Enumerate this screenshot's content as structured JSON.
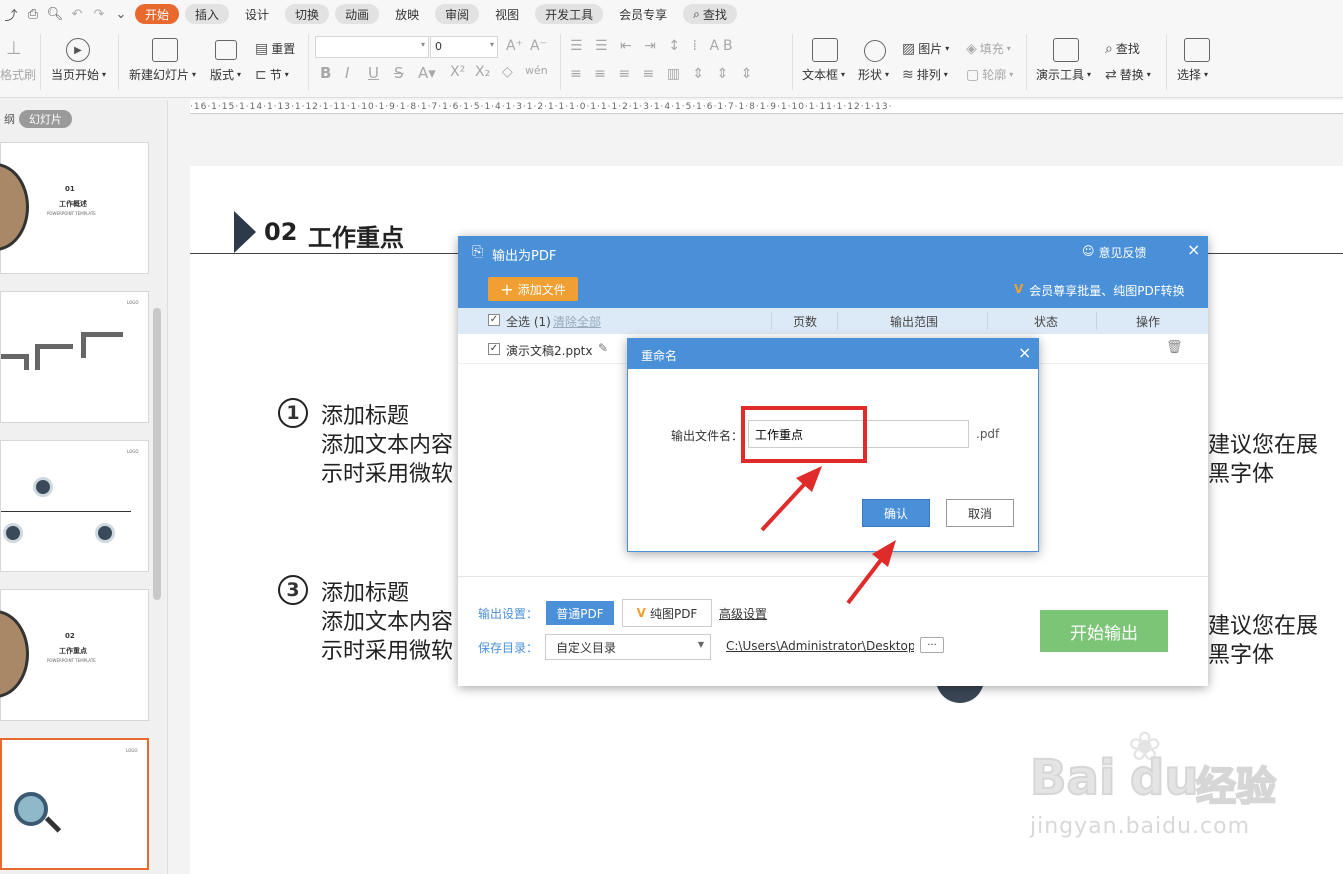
{
  "tabs": {
    "items": [
      {
        "label": "开始",
        "state": "active"
      },
      {
        "label": "插入",
        "state": "gray"
      },
      {
        "label": "设计",
        "state": ""
      },
      {
        "label": "切换",
        "state": "gray"
      },
      {
        "label": "动画",
        "state": "gray"
      },
      {
        "label": "放映",
        "state": ""
      },
      {
        "label": "审阅",
        "state": "gray"
      },
      {
        "label": "视图",
        "state": ""
      },
      {
        "label": "开发工具",
        "state": "gray"
      },
      {
        "label": "会员专享",
        "state": ""
      }
    ],
    "search": "查找"
  },
  "ribbon": {
    "format_painter": "格式刷",
    "from_start": "当页开始",
    "new_slide": "新建幻灯片",
    "layout": "版式",
    "reset": "重置",
    "section": "节",
    "font_name": "",
    "font_size": "0",
    "text_box": "文本框",
    "shape": "形状",
    "picture": "图片",
    "arrange": "排列",
    "fill": "填充",
    "outline": "轮廓",
    "present_tools": "演示工具",
    "find": "查找",
    "replace": "替换",
    "select": "选择"
  },
  "ruler_text": "·16·1·15·1·14·1·13·1·12·1·11·1·10·1·9·1·8·1·7·1·6·1·5·1·4·1·3·1·2·1·1·1·0·1·1·1·2·1·3·1·4·1·5·1·6·1·7·1·8·1·9·1·10·1·11·1·12·1·13·",
  "left_panel": {
    "view_outline": "纲",
    "view_slides": "幻灯片",
    "thumbs": [
      {
        "num": "01",
        "title": "工作概述",
        "sub": "POWERPOINT TEMPLATE"
      },
      {
        "logo": "LOGO"
      },
      {
        "logo": "LOGO"
      },
      {
        "num": "02",
        "title": "工作重点",
        "sub": "POWERPOINT TEMPLATE"
      },
      {
        "logo": "LOGO"
      }
    ]
  },
  "slide": {
    "section_num": "02",
    "section_title": "工作重点",
    "item1_num": "1",
    "item1_title": "添加标题",
    "item1_line1": "添加文本内容",
    "item1_line2": "示时采用微软",
    "item1_right1": "建议您在展",
    "item1_right2": "黑字体",
    "item3_num": "3",
    "item3_title": "添加标题",
    "item3_line1": "添加文本内容",
    "item3_line2": "示时采用微软",
    "item3_right1": "建议您在展",
    "item3_right2": "黑字体"
  },
  "pdf_dialog": {
    "title": "输出为PDF",
    "feedback": "意见反馈",
    "add_file": "添加文件",
    "vip_note": "会员尊享批量、纯图PDF转换",
    "select_all": "全选 (1)",
    "clear_all": "清除全部",
    "col_pages": "页数",
    "col_range": "输出范围",
    "col_status": "状态",
    "col_action": "操作",
    "file_name": "演示文稿2.pptx",
    "output_settings_label": "输出设置：",
    "normal_pdf": "普通PDF",
    "image_pdf": "纯图PDF",
    "advanced": "高级设置",
    "save_dir_label": "保存目录：",
    "save_dir_value": "自定义目录",
    "save_path": "C:\\Users\\Administrator\\Desktop\\",
    "more": "···",
    "start": "开始输出"
  },
  "rename_dialog": {
    "title": "重命名",
    "label": "输出文件名：",
    "value": "工作重点",
    "ext": ".pdf",
    "ok": "确认",
    "cancel": "取消"
  },
  "watermark": {
    "brand": "Bai",
    "brand2": "du",
    "cn": "经验",
    "url": "jingyan.baidu.com"
  },
  "colors": {
    "accent": "#e8692d",
    "dialog_blue": "#4a90d9",
    "start_green": "#7cc576",
    "annotation_red": "#e02b2b"
  }
}
